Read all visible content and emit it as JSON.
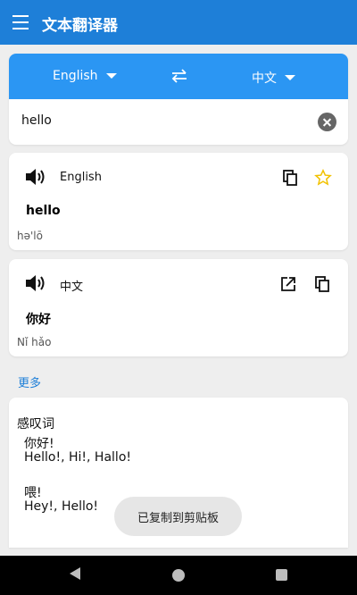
{
  "app": {
    "title": "文本翻译器"
  },
  "language_bar": {
    "source_language": "English",
    "target_language": "中文",
    "accent_color": "#2b96f3"
  },
  "input": {
    "value": "hello"
  },
  "source_card": {
    "language": "English",
    "text": "hello",
    "phonetic": "hə'lō"
  },
  "target_card": {
    "language": "中文",
    "text": "你好",
    "phonetic": "Nǐ hǎo"
  },
  "more_label": "更多",
  "dictionary": {
    "part_of_speech": "感叹词",
    "entries": [
      {
        "word": "你好!",
        "translations": "Hello!, Hi!, Hallo!"
      },
      {
        "word": "喂!",
        "translations": "Hey!, Hello!"
      }
    ]
  },
  "toast": "已复制到剪贴板",
  "icons": {
    "menu": "menu-icon",
    "swap": "swap-icon",
    "clear": "clear-icon",
    "speaker": "speaker-icon",
    "copy": "copy-icon",
    "favorite": "star-icon",
    "open": "open-external-icon"
  }
}
